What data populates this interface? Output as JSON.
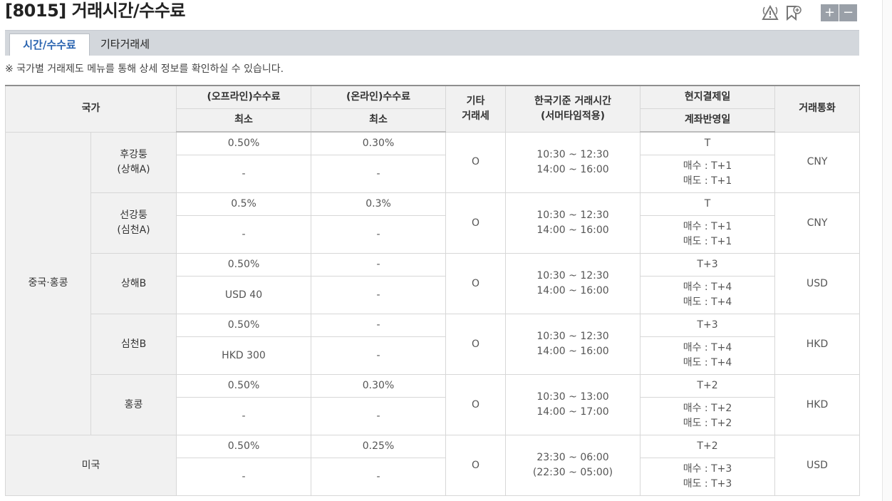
{
  "title": "[8015] 거래시간/수수료",
  "icons": [
    "warning-signal-icon",
    "bookmark-add-icon"
  ],
  "zoom": {
    "plus": "+",
    "minus": "−"
  },
  "tabs": [
    {
      "label": "시간/수수료",
      "active": true
    },
    {
      "label": "기타거래세",
      "active": false
    }
  ],
  "notice": "※ 국가별 거래제도 메뉴를 통해 상세 정보를 확인하실 수 있습니다.",
  "headers": {
    "country": "국가",
    "offline_fee": "(오프라인)수수료",
    "online_fee": "(온라인)수수료",
    "other_tax_1": "기타",
    "other_tax_2": "거래세",
    "trading_hours_1": "한국기준 거래시간",
    "trading_hours_2": "(서머타임적용)",
    "settlement": "현지결제일",
    "min_offline": "최소",
    "min_online": "최소",
    "account_reflect": "계좌반영일",
    "currency": "거래통화"
  },
  "groups": [
    {
      "name": "중국·홍콩",
      "markets": [
        {
          "name1": "후강퉁",
          "name2": "(상해A)",
          "offline": "0.50%",
          "online": "0.30%",
          "offline_min": "-",
          "online_min": "-",
          "tax": "O",
          "hours1": "10:30 ~ 12:30",
          "hours2": "14:00 ~ 16:00",
          "settle": "T",
          "buy": "매수 : T+1",
          "sell": "매도 : T+1",
          "currency": "CNY"
        },
        {
          "name1": "선강퉁",
          "name2": "(심천A)",
          "offline": "0.5%",
          "online": "0.3%",
          "offline_min": "-",
          "online_min": "-",
          "tax": "O",
          "hours1": "10:30 ~ 12:30",
          "hours2": "14:00 ~ 16:00",
          "settle": "T",
          "buy": "매수 : T+1",
          "sell": "매도 : T+1",
          "currency": "CNY"
        },
        {
          "name1": "상해B",
          "name2": "",
          "offline": "0.50%",
          "online": "-",
          "offline_min": "USD 40",
          "online_min": "-",
          "tax": "O",
          "hours1": "10:30 ~ 12:30",
          "hours2": "14:00 ~ 16:00",
          "settle": "T+3",
          "buy": "매수 : T+4",
          "sell": "매도 : T+4",
          "currency": "USD"
        },
        {
          "name1": "심천B",
          "name2": "",
          "offline": "0.50%",
          "online": "-",
          "offline_min": "HKD 300",
          "online_min": "-",
          "tax": "O",
          "hours1": "10:30 ~ 12:30",
          "hours2": "14:00 ~ 16:00",
          "settle": "T+3",
          "buy": "매수 : T+4",
          "sell": "매도 : T+4",
          "currency": "HKD"
        },
        {
          "name1": "홍콩",
          "name2": "",
          "offline": "0.50%",
          "online": "0.30%",
          "offline_min": "-",
          "online_min": "-",
          "tax": "O",
          "hours1": "10:30 ~ 13:00",
          "hours2": "14:00 ~ 17:00",
          "settle": "T+2",
          "buy": "매수 : T+2",
          "sell": "매도 : T+2",
          "currency": "HKD"
        }
      ]
    },
    {
      "name": "미국",
      "markets": [
        {
          "name1": "",
          "name2": "",
          "offline": "0.50%",
          "online": "0.25%",
          "offline_min": "-",
          "online_min": "-",
          "tax": "O",
          "hours1": "23:30 ~ 06:00",
          "hours2": "(22:30 ~ 05:00)",
          "settle": "T+2",
          "buy": "매수 : T+3",
          "sell": "매도 : T+3",
          "currency": "USD"
        }
      ]
    }
  ]
}
